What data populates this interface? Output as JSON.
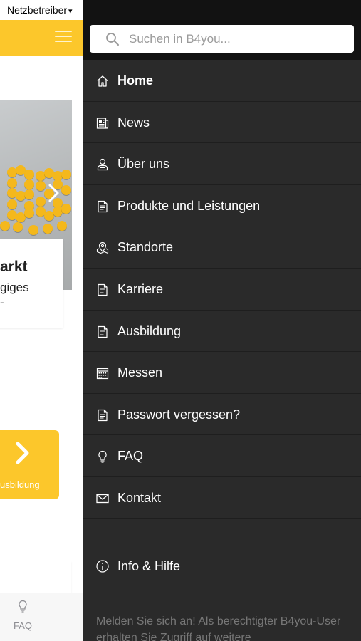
{
  "status_bar": {
    "carrier": "Netzbetreiber"
  },
  "main_page": {
    "card_title": "arkt",
    "card_text_line1": "giges",
    "card_text_line2": "-",
    "tile_label": "usbildung",
    "tab_faq_label": "FAQ",
    "accent_color": "#fcc72b"
  },
  "drawer": {
    "search": {
      "placeholder": "Suchen in B4you..."
    },
    "items": [
      {
        "label": "Home",
        "icon": "home-icon",
        "active": true
      },
      {
        "label": "News",
        "icon": "news-icon"
      },
      {
        "label": "Über uns",
        "icon": "person-icon"
      },
      {
        "label": "Produkte und Leistungen",
        "icon": "document-icon"
      },
      {
        "label": "Standorte",
        "icon": "map-pin-icon"
      },
      {
        "label": "Karriere",
        "icon": "document-icon"
      },
      {
        "label": "Ausbildung",
        "icon": "document-icon"
      },
      {
        "label": "Messen",
        "icon": "calendar-icon"
      },
      {
        "label": "Passwort vergessen?",
        "icon": "document-icon"
      },
      {
        "label": "FAQ",
        "icon": "lightbulb-icon"
      },
      {
        "label": "Kontakt",
        "icon": "mail-icon"
      }
    ],
    "info": {
      "label": "Info & Hilfe",
      "icon": "info-icon"
    },
    "login_hint": "Melden Sie sich an! Als berechtigter B4you-User erhalten Sie Zugriff auf weitere"
  }
}
